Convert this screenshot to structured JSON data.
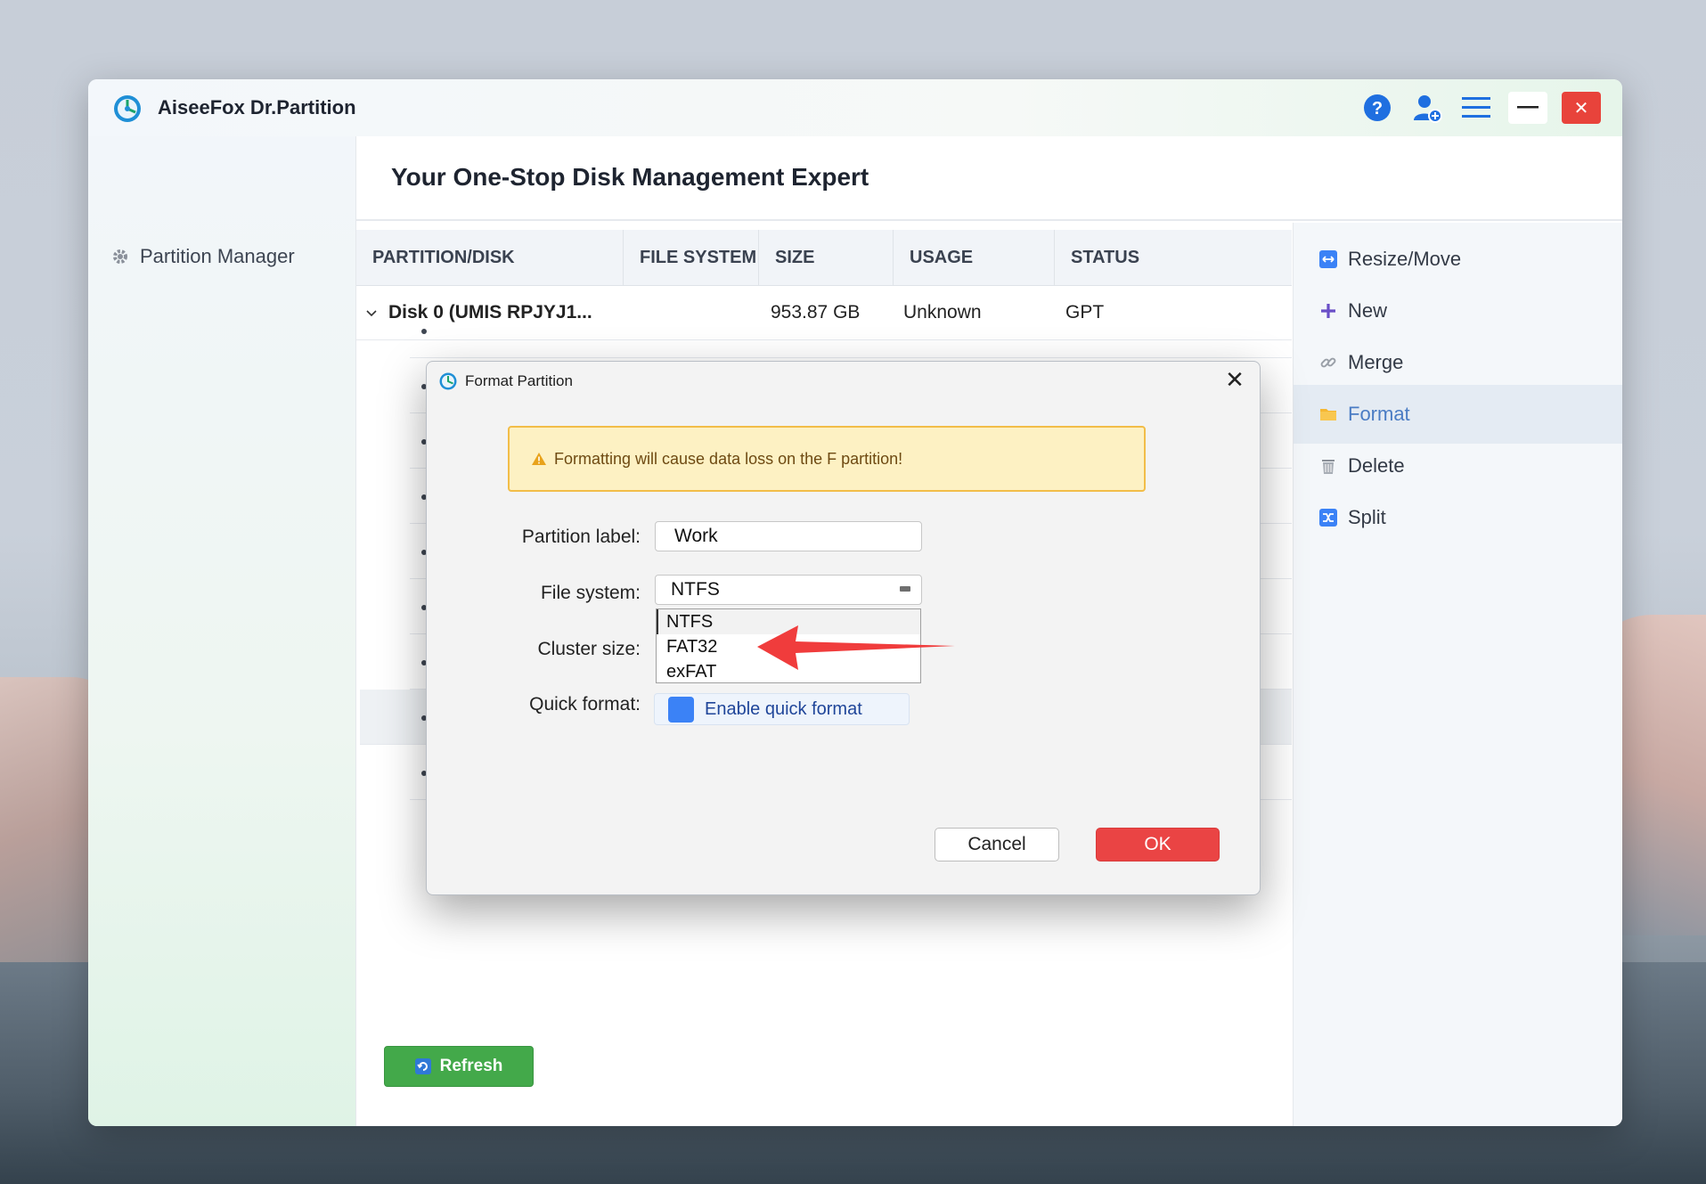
{
  "app": {
    "title": "AiseeFox Dr.Partition"
  },
  "sidebar": {
    "items": [
      {
        "label": "Partition Manager"
      }
    ]
  },
  "main": {
    "heading": "Your One-Stop Disk Management Expert",
    "columns": [
      "PARTITION/DISK",
      "FILE SYSTEM",
      "SIZE",
      "USAGE",
      "STATUS"
    ],
    "disk": {
      "name": "Disk 0 (UMIS RPJYJ1...",
      "size": "953.87 GB",
      "usage": "Unknown",
      "status": "GPT"
    },
    "refresh_label": "Refresh"
  },
  "actions": [
    {
      "label": "Resize/Move",
      "icon": "resize-icon"
    },
    {
      "label": "New",
      "icon": "plus-icon"
    },
    {
      "label": "Merge",
      "icon": "link-icon"
    },
    {
      "label": "Format",
      "icon": "folder-icon"
    },
    {
      "label": "Delete",
      "icon": "trash-icon"
    },
    {
      "label": "Split",
      "icon": "split-icon"
    }
  ],
  "dialog": {
    "title": "Format Partition",
    "warning": "Formatting will cause data loss on the F partition!",
    "partition_label": {
      "label": "Partition label:",
      "value": "Work"
    },
    "file_system": {
      "label": "File system:",
      "value": "NTFS",
      "options": [
        "NTFS",
        "FAT32",
        "exFAT"
      ]
    },
    "cluster_size": {
      "label": "Cluster size:"
    },
    "quick_format": {
      "label": "Quick format:",
      "checkbox_label": "Enable quick format"
    },
    "cancel_label": "Cancel",
    "ok_label": "OK"
  },
  "colors": {
    "accent": "#4a7cc4",
    "ok": "#ea4444",
    "refresh": "#43a94a",
    "warning_bg": "#fdf1c3",
    "annotation_arrow": "#f03c3c"
  }
}
